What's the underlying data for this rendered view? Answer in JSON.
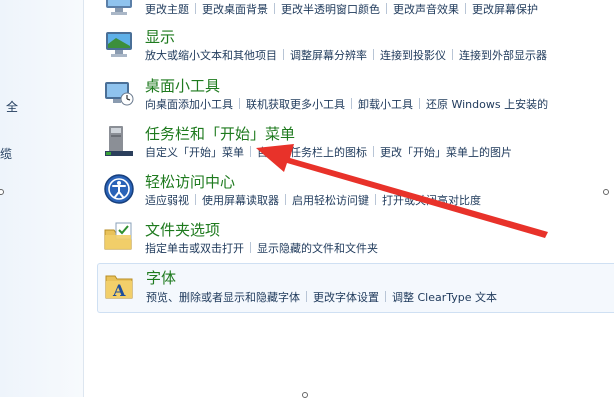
{
  "left_pane": {
    "fragment_1": "全",
    "fragment_2": "缆"
  },
  "categories": [
    {
      "title": "",
      "icon": "monitor-personalize-icon",
      "links": [
        "更改主题",
        "更改桌面背景",
        "更改半透明窗口颜色",
        "更改声音效果",
        "更改屏幕保护"
      ]
    },
    {
      "title": "显示",
      "icon": "display-icon",
      "links": [
        "放大或缩小文本和其他项目",
        "调整屏幕分辨率",
        "连接到投影仪",
        "连接到外部显示器"
      ]
    },
    {
      "title": "桌面小工具",
      "icon": "gadgets-icon",
      "links": [
        "向桌面添加小工具",
        "联机获取更多小工具",
        "卸载小工具",
        "还原 Windows 上安装的"
      ]
    },
    {
      "title": "任务栏和「开始」菜单",
      "icon": "taskbar-icon",
      "links": [
        "自定义「开始」菜单",
        "自定义任务栏上的图标",
        "更改「开始」菜单上的图片"
      ]
    },
    {
      "title": "轻松访问中心",
      "icon": "ease-of-access-icon",
      "links": [
        "适应弱视",
        "使用屏幕读取器",
        "启用轻松访问键",
        "打开或关闭高对比度"
      ]
    },
    {
      "title": "文件夹选项",
      "icon": "folder-options-icon",
      "links": [
        "指定单击或双击打开",
        "显示隐藏的文件和文件夹"
      ]
    },
    {
      "title": "字体",
      "icon": "fonts-icon",
      "links": [
        "预览、删除或者显示和隐藏字体",
        "更改字体设置",
        "调整 ClearType 文本"
      ]
    }
  ],
  "colors": {
    "title_green": "#1e7a1e",
    "link_blue": "#1e395b",
    "arrow_red": "#e8322a"
  }
}
